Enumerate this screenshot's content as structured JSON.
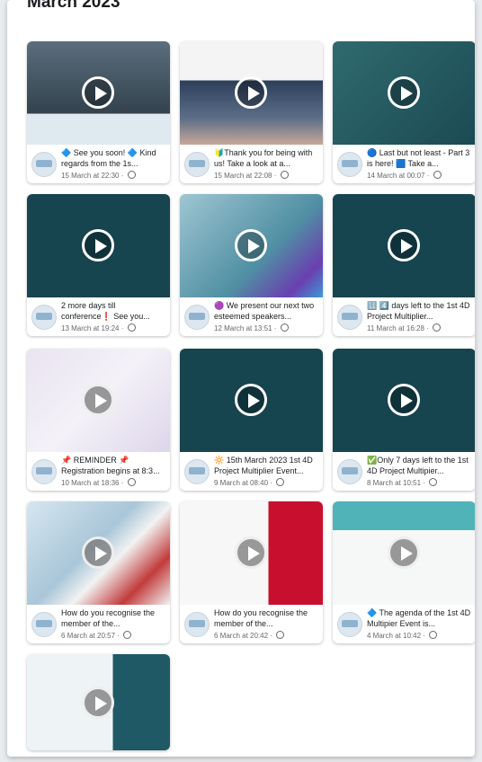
{
  "header": {
    "month": "March 2023"
  },
  "posts": [
    {
      "caption": "🔷 See you soon! 🔷 Kind regards from the 1s...",
      "date": "15 March at 22:30"
    },
    {
      "caption": "🔰Thank you for being with us! Take a look at a...",
      "date": "15 March at 22:08"
    },
    {
      "caption": "🔵 Last but not least - Part 3 is here! 🟦 Take a...",
      "date": "14 March at 00:07"
    },
    {
      "caption": "2 more days till conference❗ See you...",
      "date": "13 March at 19:24"
    },
    {
      "caption": "🟣 We present our next two esteemed speakers...",
      "date": "12 March at 13:51"
    },
    {
      "caption": "🔢 4️⃣ days left to the 1st 4D Project Multiplier...",
      "date": "11 March at 16:28"
    },
    {
      "caption": "📌 REMINDER 📌 Registration begins at 8:3...",
      "date": "10 March at 18:36"
    },
    {
      "caption": "🔆 15th March 2023 1st 4D Project Multiplier Event...",
      "date": "9 March at 08:40"
    },
    {
      "caption": "✅Only 7 days left to the 1st 4D Project Multipier...",
      "date": "8 March at 10:51"
    },
    {
      "caption": "How do you recognise the member of the...",
      "date": "6 March at 20:57"
    },
    {
      "caption": "How do you recognise the member of the...",
      "date": "6 March at 20:42"
    },
    {
      "caption": "🔷 The agenda of the 1st 4D Multipier Event is...",
      "date": "4 March at 10:42"
    },
    {
      "caption": "",
      "date": ""
    }
  ],
  "colors": {
    "accent": "#16444f",
    "text": "#1c1e21",
    "muted": "#65676b"
  }
}
